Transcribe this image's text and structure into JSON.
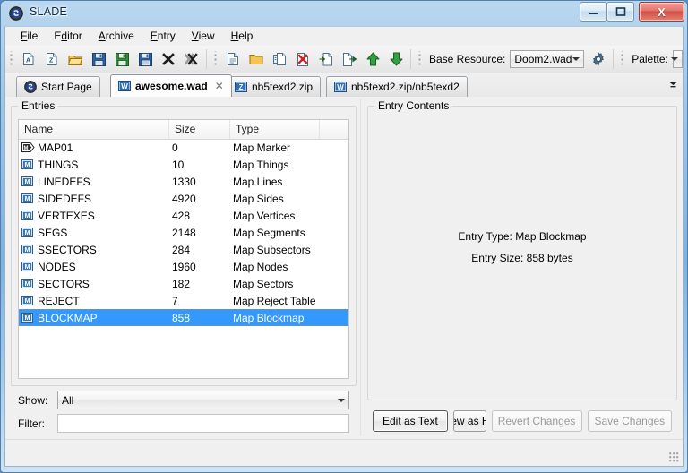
{
  "window": {
    "title": "SLADE",
    "icon": "slade-logo-icon",
    "buttons": {
      "minimize": "minimize-icon",
      "maximize": "maximize-icon",
      "close": "close-icon",
      "close_glyph": "X"
    }
  },
  "menu": {
    "items": [
      {
        "label": "File",
        "mnemonic": "F"
      },
      {
        "label": "Editor",
        "mnemonic": "d"
      },
      {
        "label": "Archive",
        "mnemonic": "A"
      },
      {
        "label": "Entry",
        "mnemonic": "E"
      },
      {
        "label": "View",
        "mnemonic": "V"
      },
      {
        "label": "Help",
        "mnemonic": "H"
      }
    ]
  },
  "toolbar": {
    "group1": [
      {
        "name": "new-archive-icon"
      },
      {
        "name": "new-zip-archive-icon"
      },
      {
        "name": "open-archive-icon"
      },
      {
        "name": "save-archive-icon"
      },
      {
        "name": "save-archive-as-icon"
      },
      {
        "name": "save-all-icon"
      },
      {
        "name": "close-archive-icon"
      },
      {
        "name": "close-all-archives-icon"
      }
    ],
    "group2": [
      {
        "name": "new-entry-icon"
      },
      {
        "name": "new-directory-icon"
      },
      {
        "name": "import-entry-icon"
      },
      {
        "name": "delete-entry-icon"
      },
      {
        "name": "import-file-icon"
      },
      {
        "name": "export-entry-icon"
      },
      {
        "name": "move-up-icon"
      },
      {
        "name": "move-down-icon"
      }
    ],
    "base_resource_label": "Base Resource:",
    "base_resource_value": "Doom2.wad",
    "base_resource_settings_icon": "gear-icon",
    "palette_label": "Palette:",
    "palette_value": ""
  },
  "tabs": {
    "items": [
      {
        "label": "Start Page",
        "icon": "slade-logo-icon",
        "active": false,
        "closable": false
      },
      {
        "label": "awesome.wad",
        "icon": "wad-archive-icon",
        "active": true,
        "closable": true
      },
      {
        "label": "nb5texd2.zip",
        "icon": "zip-archive-icon",
        "active": false,
        "closable": false
      },
      {
        "label": "nb5texd2.zip/nb5texd2",
        "icon": "wad-archive-icon",
        "active": false,
        "closable": false
      }
    ],
    "close_glyph": "✕",
    "overflow_icon": "tab-overflow-icon"
  },
  "entries_panel": {
    "title": "Entries",
    "columns": [
      "Name",
      "Size",
      "Type"
    ],
    "rows": [
      {
        "name": "MAP01",
        "size": "0",
        "type": "Map Marker",
        "icon": "map-marker-icon",
        "selected": false
      },
      {
        "name": "THINGS",
        "size": "10",
        "type": "Map Things",
        "icon": "map-entry-icon",
        "selected": false
      },
      {
        "name": "LINEDEFS",
        "size": "1330",
        "type": "Map Lines",
        "icon": "map-entry-icon",
        "selected": false
      },
      {
        "name": "SIDEDEFS",
        "size": "4920",
        "type": "Map Sides",
        "icon": "map-entry-icon",
        "selected": false
      },
      {
        "name": "VERTEXES",
        "size": "428",
        "type": "Map Vertices",
        "icon": "map-entry-icon",
        "selected": false
      },
      {
        "name": "SEGS",
        "size": "2148",
        "type": "Map Segments",
        "icon": "map-entry-icon",
        "selected": false
      },
      {
        "name": "SSECTORS",
        "size": "284",
        "type": "Map Subsectors",
        "icon": "map-entry-icon",
        "selected": false
      },
      {
        "name": "NODES",
        "size": "1960",
        "type": "Map Nodes",
        "icon": "map-entry-icon",
        "selected": false
      },
      {
        "name": "SECTORS",
        "size": "182",
        "type": "Map Sectors",
        "icon": "map-entry-icon",
        "selected": false
      },
      {
        "name": "REJECT",
        "size": "7",
        "type": "Map Reject Table",
        "icon": "map-entry-icon",
        "selected": false
      },
      {
        "name": "BLOCKMAP",
        "size": "858",
        "type": "Map Blockmap",
        "icon": "map-entry-icon",
        "selected": true
      }
    ],
    "show_label": "Show:",
    "show_value": "All",
    "filter_label": "Filter:",
    "filter_value": "",
    "filter_placeholder": ""
  },
  "contents_panel": {
    "title": "Entry Contents",
    "entry_type_line": "Entry Type: Map Blockmap",
    "entry_size_line": "Entry Size: 858 bytes",
    "buttons": [
      {
        "label": "Edit as Text",
        "state": "default",
        "clipped": false
      },
      {
        "label": "View as Hex",
        "state": "normal",
        "clipped": true
      },
      {
        "label": "Revert Changes",
        "state": "disabled",
        "clipped": false
      },
      {
        "label": "Save Changes",
        "state": "disabled",
        "clipped": false
      }
    ]
  },
  "statusbar": {
    "text": "",
    "grip_icon": "resize-grip-icon"
  },
  "colors": {
    "selection": "#3399ff",
    "window_bg": "#f0f0f0",
    "list_bg": "#ffffff",
    "close_button": "#cf4e43"
  }
}
